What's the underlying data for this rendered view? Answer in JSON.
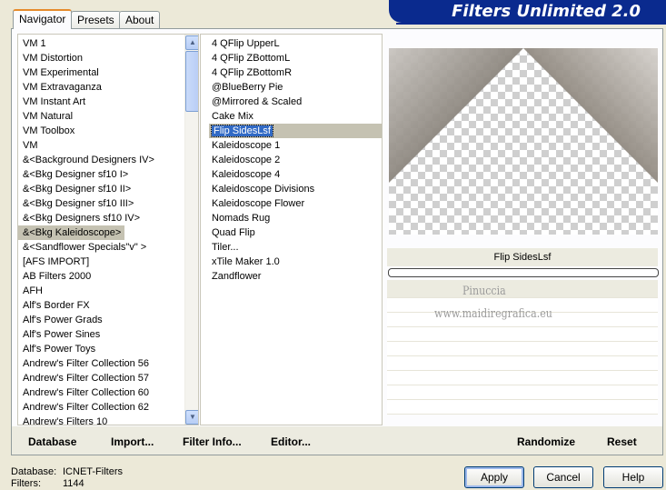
{
  "tabs": [
    {
      "label": "Navigator",
      "active": true
    },
    {
      "label": "Presets",
      "active": false
    },
    {
      "label": "About",
      "active": false
    }
  ],
  "banner": {
    "title": "Filters Unlimited 2.0"
  },
  "categories": [
    "VM 1",
    "VM Distortion",
    "VM Experimental",
    "VM Extravaganza",
    "VM Instant Art",
    "VM Natural",
    "VM Toolbox",
    "VM",
    "&<Background Designers IV>",
    "&<Bkg Designer sf10 I>",
    "&<Bkg Designer sf10 II>",
    "&<Bkg Designer sf10 III>",
    "&<Bkg Designers sf10 IV>",
    "&<Bkg Kaleidoscope>",
    "&<Sandflower Specials\"v\" >",
    "[AFS IMPORT]",
    "AB Filters 2000",
    "AFH",
    "Alf's Border FX",
    "Alf's Power Grads",
    "Alf's Power Sines",
    "Alf's Power Toys",
    "Andrew's Filter Collection 56",
    "Andrew's Filter Collection 57",
    "Andrew's Filter Collection 60",
    "Andrew's Filter Collection 62",
    "Andrew's Filters 10"
  ],
  "selected_category": "&<Bkg Kaleidoscope>",
  "filters": [
    "4 QFlip UpperL",
    "4 QFlip ZBottomL",
    "4 QFlip ZBottomR",
    "@BlueBerry Pie",
    "@Mirrored & Scaled",
    "Cake Mix",
    "Flip SidesLsf",
    "Kaleidoscope 1",
    "Kaleidoscope 2",
    "Kaleidoscope 4",
    "Kaleidoscope Divisions",
    "Kaleidoscope Flower",
    "Nomads Rug",
    "Quad Flip",
    "Tiler...",
    "xTile Maker 1.0",
    "Zandflower"
  ],
  "selected_filter": "Flip SidesLsf",
  "watermark": {
    "line1": "Pinuccia",
    "line2": "www.maidiregrafica.eu"
  },
  "bottom_buttons": {
    "database": "Database",
    "import": "Import...",
    "filter_info": "Filter Info...",
    "editor": "Editor...",
    "randomize": "Randomize",
    "reset": "Reset"
  },
  "status": {
    "database_label": "Database:",
    "database_value": "ICNET-Filters",
    "filters_label": "Filters:",
    "filters_value": "1144"
  },
  "buttons": {
    "apply": "Apply",
    "cancel": "Cancel",
    "help": "Help"
  },
  "icons": {
    "scroll_up": "triangle-up",
    "scroll_down": "triangle-down"
  },
  "colors": {
    "banner": "#0a2a8e",
    "selection": "#316ac5",
    "tab_highlight": "#e68b2c"
  }
}
